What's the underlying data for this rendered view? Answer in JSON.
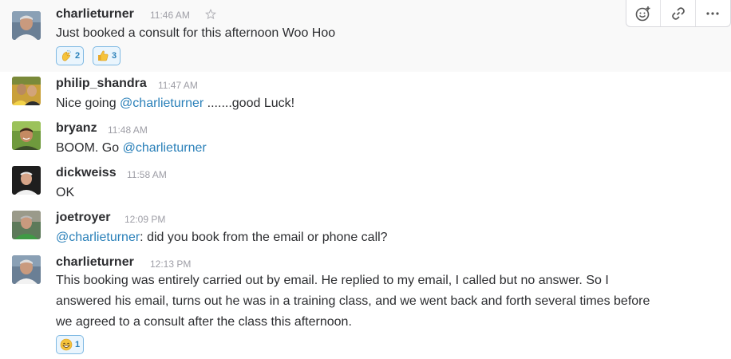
{
  "colors": {
    "mention": "#2a80b9",
    "reaction_bg": "#eaf5fd",
    "reaction_border": "#7fb9e3",
    "hover_bg": "#f9f9f9"
  },
  "messages": [
    {
      "username": "charlieturner",
      "time": "11:46 AM",
      "text": "Just booked a consult for this afternoon Woo Hoo",
      "reactions": [
        {
          "icon": "clapping-hands-icon",
          "count": "2"
        },
        {
          "icon": "thumbs-up-icon",
          "count": "3"
        }
      ]
    },
    {
      "username": "philip_shandra",
      "time": "11:47 AM",
      "text_before": "Nice going ",
      "mention": "@charlieturner",
      "text_after": "  .......good Luck!"
    },
    {
      "username": "bryanz",
      "time": "11:48 AM",
      "text_before": "BOOM. Go ",
      "mention": "@charlieturner"
    },
    {
      "username": "dickweiss",
      "time": "11:58 AM",
      "text": "OK"
    },
    {
      "username": "joetroyer",
      "time": "12:09 PM",
      "mention": "@charlieturner",
      "text_after": ": did you book from the email or phone call?"
    },
    {
      "username": "charlieturner",
      "time": "12:13 PM",
      "lines": [
        "This booking was entirely carried out by email. He replied to my  email, I called but no answer. So I",
        "answered his email, turns out he was in a training class, and we went back and forth several times before",
        "we agreed to a consult after the class this afternoon."
      ],
      "reactions": [
        {
          "icon": "grinning-face-icon",
          "count": "1"
        }
      ]
    }
  ],
  "actions": [
    {
      "icon": "add-reaction-icon"
    },
    {
      "icon": "copy-link-icon"
    },
    {
      "icon": "more-actions-icon"
    }
  ]
}
